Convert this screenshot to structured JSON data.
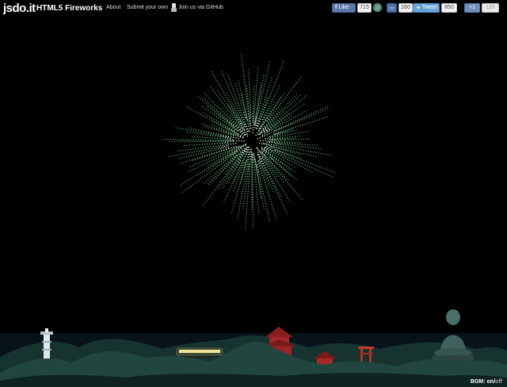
{
  "header": {
    "logo": "jsdo.it",
    "title": "HTML5 Fireworks",
    "nav": {
      "about": "About",
      "submit": "Submit your own",
      "github": "Join us via GitHub"
    }
  },
  "social": {
    "facebook": {
      "label": "Like",
      "count": "715"
    },
    "hatena": {
      "count": "160"
    },
    "twitter": {
      "label": "Tweet",
      "count": "850"
    },
    "google": {
      "label": "+1",
      "count": "126"
    }
  },
  "footer": {
    "bgm_label": "BGM:",
    "bgm_on": "on",
    "bgm_sep": "/",
    "bgm_off": "off"
  },
  "colors": {
    "firework": "#7fe0a0",
    "firework_core": "#d9ffe0",
    "sky": "#000000",
    "hills": "#1d3f3a"
  }
}
